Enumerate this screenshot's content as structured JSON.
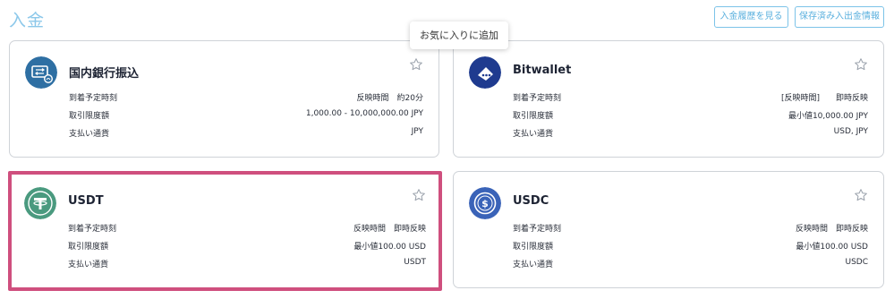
{
  "header": {
    "title": "入金",
    "history_button": "入金履歴を見る",
    "saved_info_button": "保存済み入出金情報"
  },
  "tooltip": "お気に入りに追加",
  "icons": {
    "favorite": "star-outline-icon",
    "domestic_bank": "bank-transfer-icon",
    "bitwallet": "bitwallet-logo-icon",
    "usdt": "tether-logo-icon",
    "usdc": "usdc-logo-icon"
  },
  "colors": {
    "accent": "#5ab0de",
    "highlight": "#cf4f7e",
    "bank_logo": "#2e6fa3",
    "bitwallet_logo": "#1f3b8f",
    "usdt_logo": "#4a9a7f",
    "usdc_logo": "#3a63b8"
  },
  "methods": [
    {
      "name": "国内銀行振込",
      "rows": [
        {
          "label": "到着予定時刻",
          "value": "反映時間　約20分"
        },
        {
          "label": "取引限度額",
          "value": "1,000.00 - 10,000,000.00 JPY"
        },
        {
          "label": "支払い通貨",
          "value": "JPY"
        }
      ]
    },
    {
      "name": "Bitwallet",
      "rows": [
        {
          "label": "到着予定時刻",
          "value": "[反映時間]　　即時反映"
        },
        {
          "label": "取引限度額",
          "value": "最小値10,000.00 JPY"
        },
        {
          "label": "支払い通貨",
          "value": "USD, JPY"
        }
      ]
    },
    {
      "name": "USDT",
      "rows": [
        {
          "label": "到着予定時刻",
          "value": "反映時間　即時反映"
        },
        {
          "label": "取引限度額",
          "value": "最小値100.00 USD"
        },
        {
          "label": "支払い通貨",
          "value": "USDT"
        }
      ]
    },
    {
      "name": "USDC",
      "rows": [
        {
          "label": "到着予定時刻",
          "value": "反映時間　即時反映"
        },
        {
          "label": "取引限度額",
          "value": "最小値100.00 USD"
        },
        {
          "label": "支払い通貨",
          "value": "USDC"
        }
      ]
    }
  ]
}
